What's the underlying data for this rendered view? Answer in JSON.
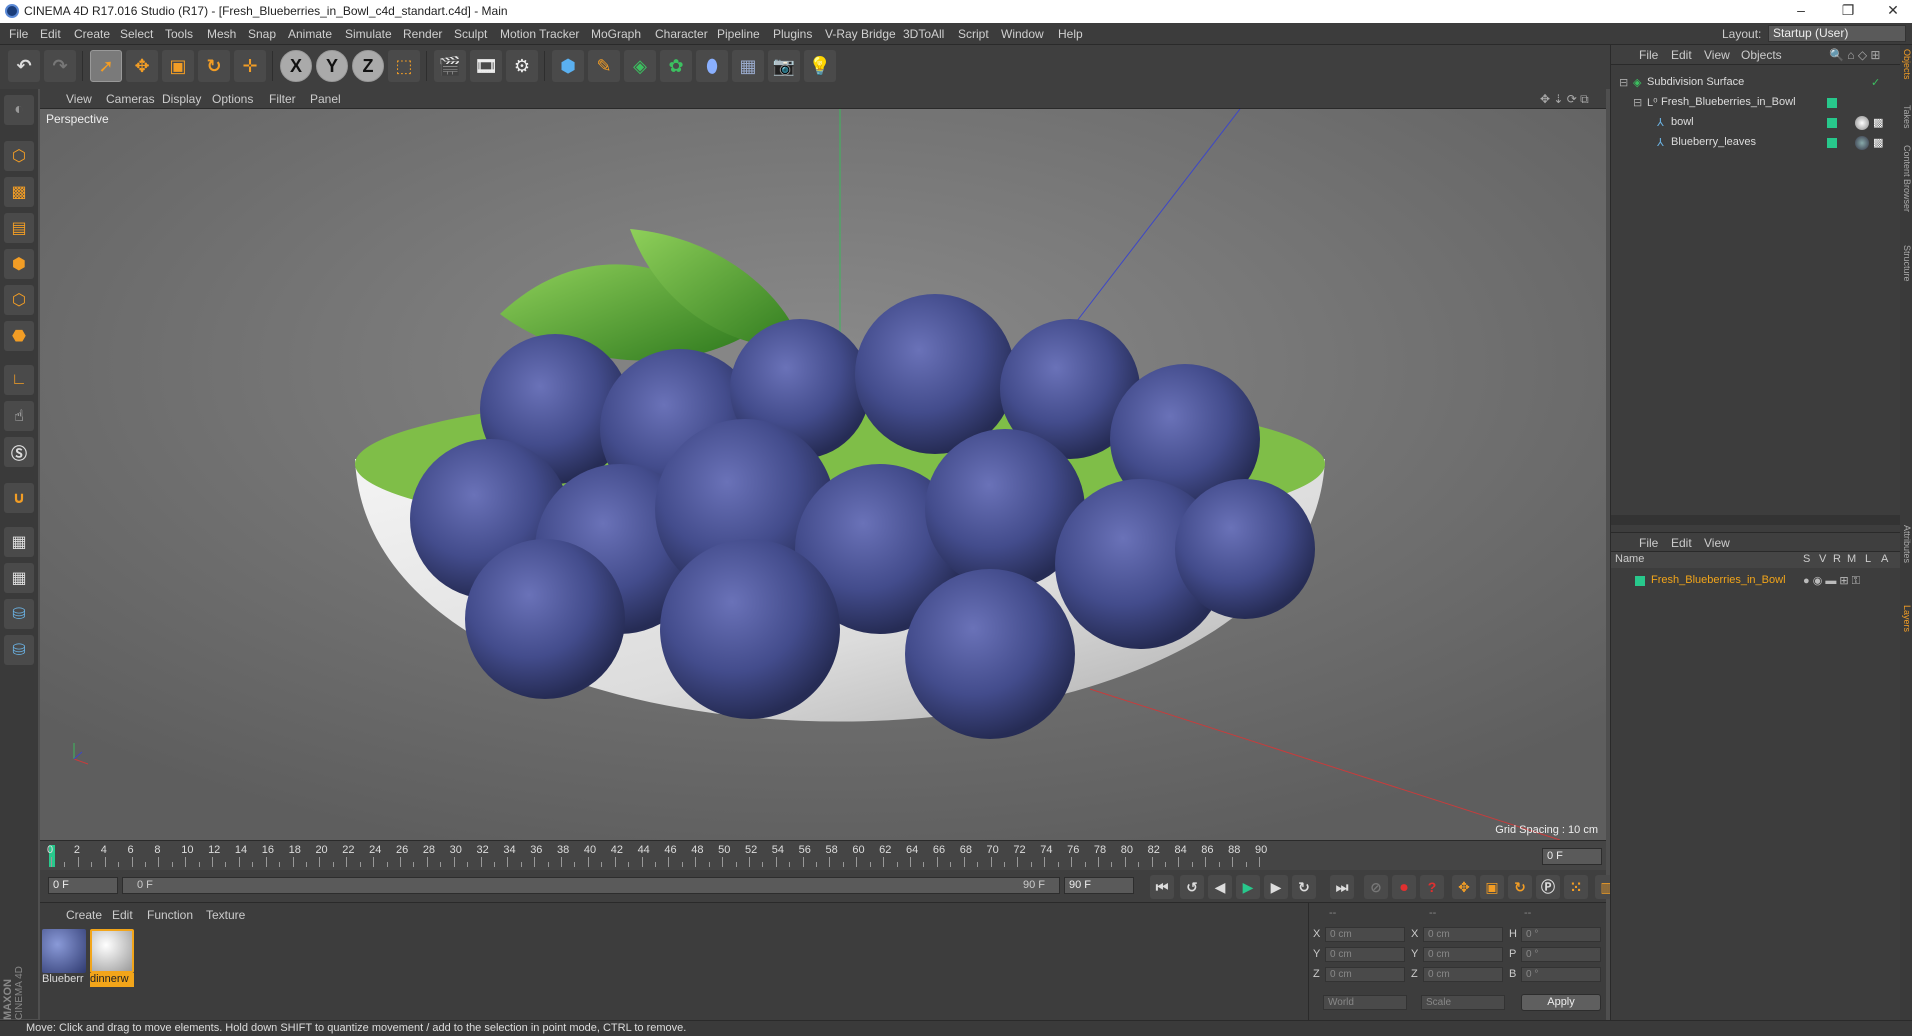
{
  "window": {
    "title": "CINEMA 4D R17.016 Studio (R17) - [Fresh_Blueberries_in_Bowl_c4d_standart.c4d] - Main",
    "minimize": "–",
    "restore": "❐",
    "close": "✕"
  },
  "menu": [
    "File",
    "Edit",
    "Create",
    "Select",
    "Tools",
    "Mesh",
    "Snap",
    "Animate",
    "Simulate",
    "Render",
    "Sculpt",
    "Motion Tracker",
    "MoGraph",
    "Character",
    "Pipeline",
    "Plugins",
    "V-Ray Bridge",
    "3DToAll",
    "Script",
    "Window",
    "Help"
  ],
  "layout": {
    "label": "Layout:",
    "value": "Startup (User)"
  },
  "toolbar": {
    "x": "X",
    "y": "Y",
    "z": "Z"
  },
  "viewport": {
    "menu": [
      "View",
      "Cameras",
      "Display",
      "Options",
      "Filter",
      "Panel"
    ],
    "camera_label": "Perspective",
    "grid_spacing": "Grid Spacing : 10 cm"
  },
  "timeline": {
    "ticks": [
      "0",
      "2",
      "4",
      "6",
      "8",
      "10",
      "12",
      "14",
      "16",
      "18",
      "20",
      "22",
      "24",
      "26",
      "28",
      "30",
      "32",
      "34",
      "36",
      "38",
      "40",
      "42",
      "44",
      "46",
      "48",
      "50",
      "52",
      "54",
      "56",
      "58",
      "60",
      "62",
      "64",
      "66",
      "68",
      "70",
      "72",
      "74",
      "76",
      "78",
      "80",
      "82",
      "84",
      "86",
      "88",
      "90"
    ],
    "current_frame": "0 F"
  },
  "playback": {
    "start": "0 F",
    "range_start": "0 F",
    "range_end": "90 F",
    "end": "90 F"
  },
  "material_manager": {
    "menu": [
      "Create",
      "Edit",
      "Function",
      "Texture"
    ],
    "materials": [
      {
        "label": "Blueberr",
        "color": "#3a4a8a"
      },
      {
        "label": "dinnerw",
        "color": "#e8e8e8"
      }
    ]
  },
  "coordinates": {
    "header": [
      "--",
      "--",
      "--"
    ],
    "rows": [
      {
        "a": "X",
        "av": "0 cm",
        "b": "X",
        "bv": "0 cm",
        "c": "H",
        "cv": "0 °"
      },
      {
        "a": "Y",
        "av": "0 cm",
        "b": "Y",
        "bv": "0 cm",
        "c": "P",
        "cv": "0 °"
      },
      {
        "a": "Z",
        "av": "0 cm",
        "b": "Z",
        "bv": "0 cm",
        "c": "B",
        "cv": "0 °"
      }
    ],
    "world": "World",
    "scale": "Scale",
    "apply": "Apply"
  },
  "object_manager": {
    "menu": [
      "File",
      "Edit",
      "View",
      "Objects"
    ],
    "items": [
      {
        "name": "Subdivision Surface",
        "indent": 0
      },
      {
        "name": "Fresh_Blueberries_in_Bowl",
        "indent": 1
      },
      {
        "name": "bowl",
        "indent": 2
      },
      {
        "name": "Blueberry_leaves",
        "indent": 2
      }
    ]
  },
  "layer_manager": {
    "menu": [
      "File",
      "Edit",
      "View"
    ],
    "columns": [
      "Name",
      "S",
      "V",
      "R",
      "M",
      "L",
      "A"
    ],
    "layer": "Fresh_Blueberries_in_Bowl"
  },
  "side_tabs": [
    "Objects",
    "Takes",
    "Content Browser",
    "Structure",
    "Attributes",
    "Layers"
  ],
  "maxon": {
    "line1": "MAXON",
    "line2": "CINEMA 4D"
  },
  "status": "Move: Click and drag to move elements. Hold down SHIFT to quantize movement / add to the selection in point mode, CTRL to remove.",
  "colors": {
    "accent": "#f29d25",
    "layer_green": "#28c88c",
    "selected_text": "#f2a51a"
  }
}
